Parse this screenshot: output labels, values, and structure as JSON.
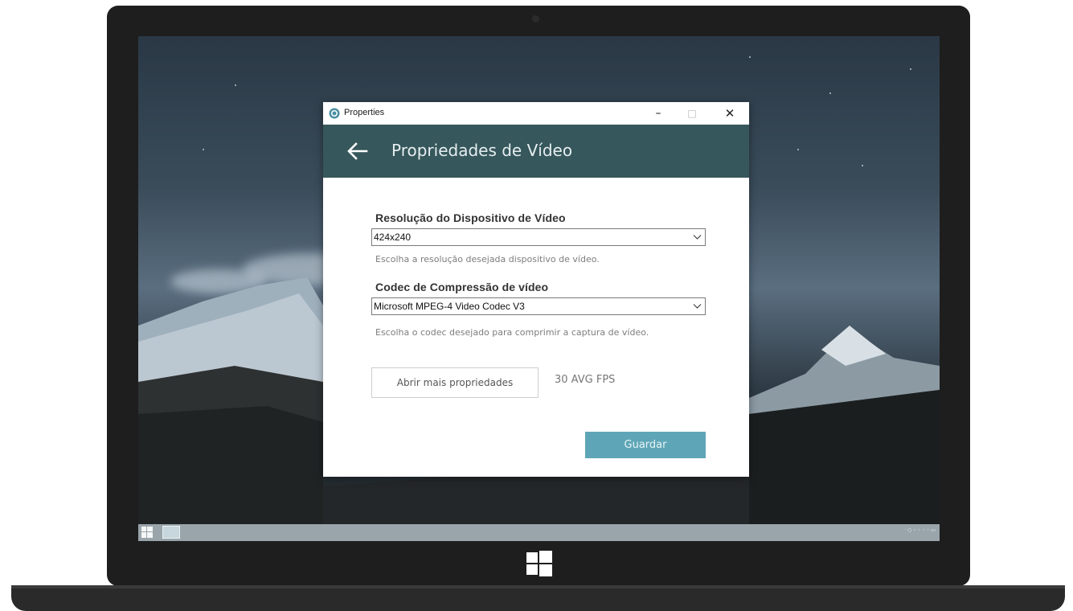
{
  "window": {
    "title": "Properties",
    "controls": {
      "minimize": "–",
      "maximize": "□",
      "close": "✕"
    }
  },
  "header": {
    "title": "Propriedades de Vídeo"
  },
  "fields": {
    "resolution": {
      "label": "Resolução do Dispositivo de Vídeo",
      "value": "424x240",
      "hint": "Escolha a resolução desejada dispositivo de vídeo."
    },
    "codec": {
      "label": "Codec de Compressão de vídeo",
      "value": "Microsoft MPEG-4 Video Codec V3",
      "hint": "Escolha o codec desejado para comprimir a captura de vídeo."
    }
  },
  "actions": {
    "more_properties": "Abrir mais propriedades",
    "fps": "30 AVG FPS",
    "save": "Guardar"
  },
  "colors": {
    "header_bg": "#36575b",
    "accent": "#5ea6b7",
    "taskbar": "#9aa5ab"
  },
  "icons": {
    "app": "app-logo-icon",
    "back": "back-arrow-icon",
    "dropdown": "chevron-down-icon",
    "start": "windows-start-icon"
  }
}
